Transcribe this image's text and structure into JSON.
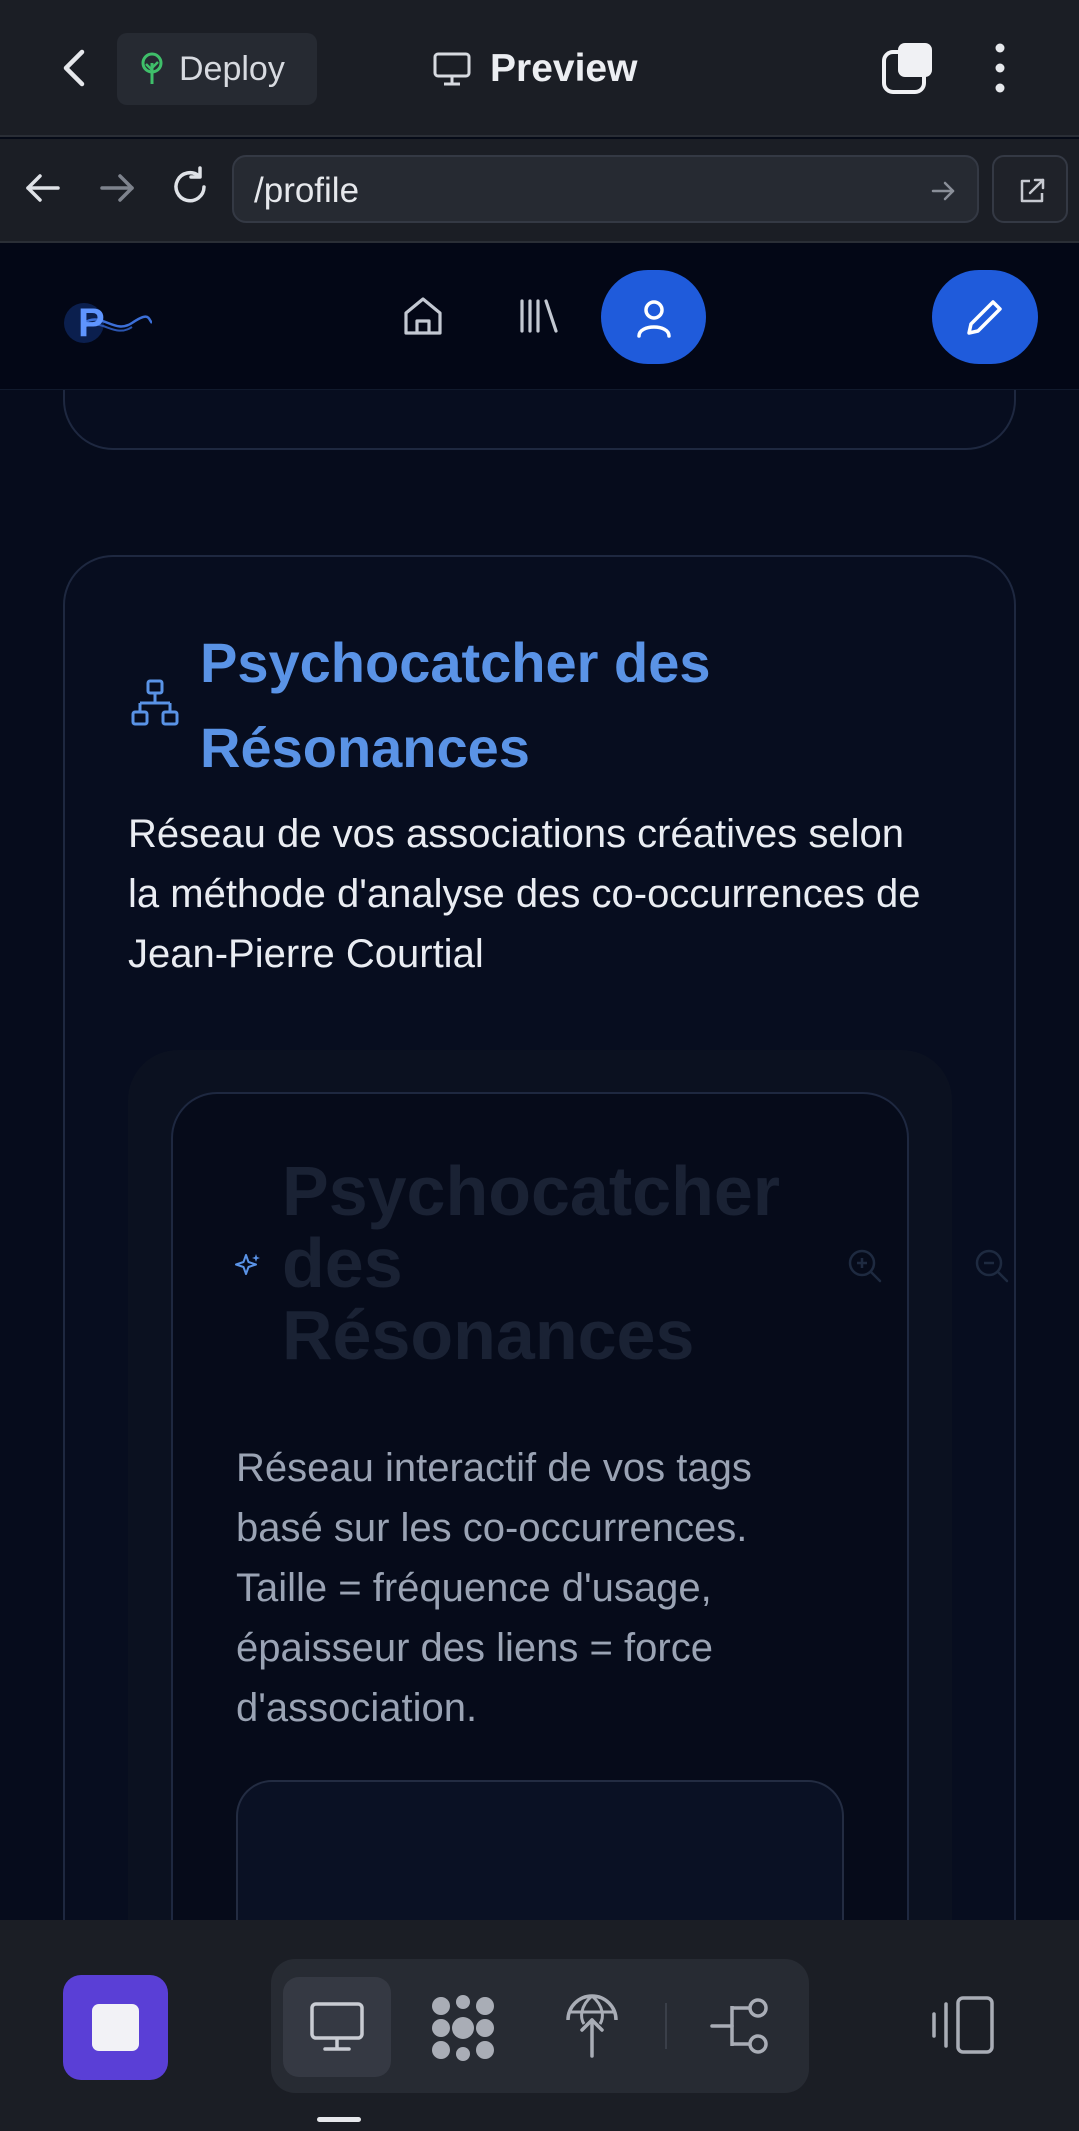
{
  "topbar": {
    "deploy_label": "Deploy",
    "preview_label": "Preview"
  },
  "urlbar": {
    "url": "/profile"
  },
  "webheader": {
    "logo_letter": "P"
  },
  "card": {
    "title": "Psychocatcher des Résonances",
    "description": "Réseau de vos associations créatives selon la méthode d'analyse des co-occurrences de Jean-Pierre Courtial"
  },
  "inner": {
    "title": "Psychocatcher des Résonances",
    "description": "Réseau interactif de vos tags basé sur les co-occurrences. Taille = fréquence d'usage, épaisseur des liens = force d'association."
  },
  "colors": {
    "accent_blue": "#1f5bdb",
    "title_blue": "#5a93e6",
    "stop_purple": "#5a3fd6",
    "deploy_green": "#3fbf6a"
  },
  "icons": {
    "back": "chevron-left-icon",
    "deploy": "tree-icon",
    "preview": "monitor-icon",
    "tabs": "tabs-icon",
    "menu": "kebab-menu-icon",
    "network": "sitemap-icon",
    "sparkle": "sparkle-icon"
  }
}
